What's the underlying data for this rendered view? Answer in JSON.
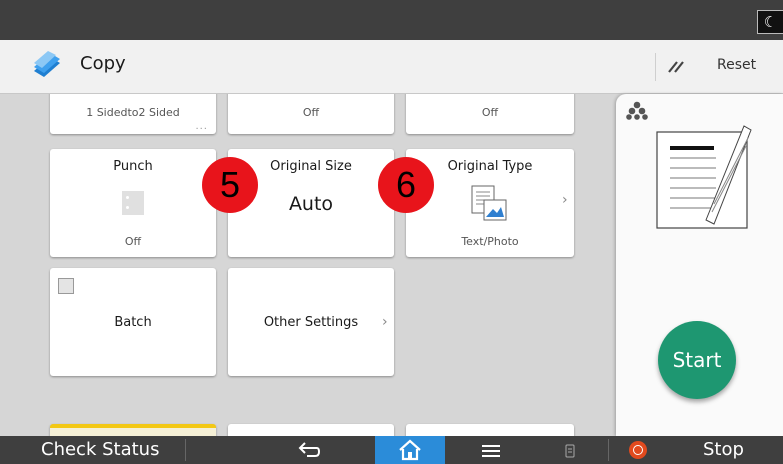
{
  "app": {
    "title": "Copy",
    "reset_label": "Reset"
  },
  "tiles_row0": [
    {
      "value": "1 Sidedto2 Sided",
      "more": "..."
    },
    {
      "value": "Off"
    },
    {
      "value": "Off"
    }
  ],
  "tiles_row1": [
    {
      "title": "Punch",
      "value": "Off"
    },
    {
      "title": "Original Size",
      "value": "Auto"
    },
    {
      "title": "Original Type",
      "value": "Text/Photo"
    }
  ],
  "tiles_row2": [
    {
      "title": "Batch"
    },
    {
      "title": "Other Settings"
    }
  ],
  "badges": [
    "5",
    "6"
  ],
  "panel": {
    "start_label": "Start"
  },
  "bottombar": {
    "check_status": "Check Status",
    "stop": "Stop"
  },
  "colors": {
    "start": "#1e9771",
    "badge": "#e8141b",
    "home": "#2b8cd9",
    "stop_icon": "#e14a1e",
    "topbar": "#3f3f3f"
  }
}
